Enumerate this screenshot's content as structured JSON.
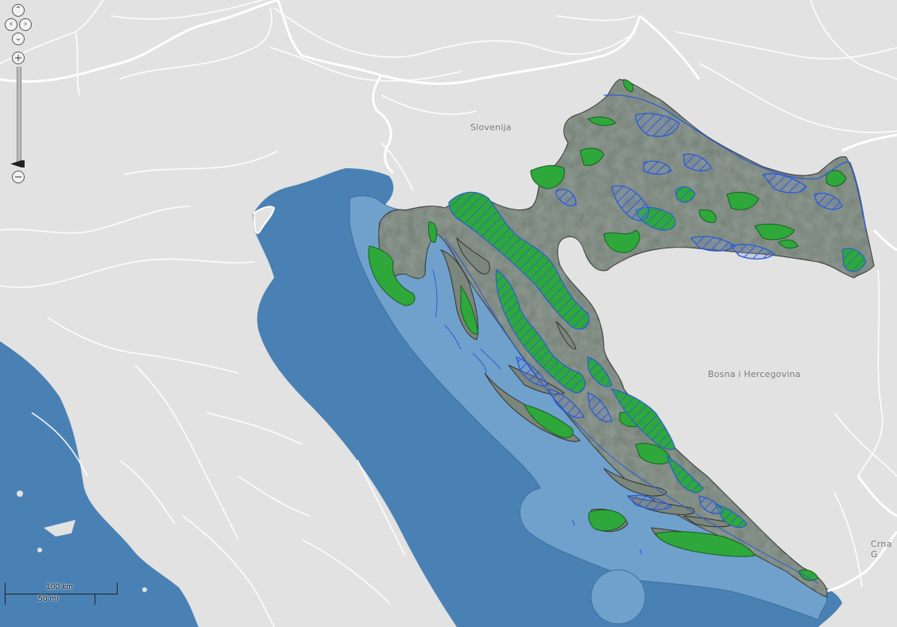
{
  "map": {
    "labels": {
      "slovenia": "Slovenija",
      "bosnia": "Bosna i Hercegovina",
      "montenegro": "Crna G"
    },
    "colors": {
      "land": "#e2e2e2",
      "sea": "#4a81b4",
      "territorial_sea": "#6fa1cc",
      "protected_area_fill": "#2ea83a",
      "protected_area_outline": "#2b5cd6",
      "border": "#ffffff",
      "satellite": "#6f7b72"
    },
    "legend_icons": [
      "pan-up-icon",
      "pan-left-icon",
      "pan-right-icon",
      "pan-down-icon",
      "zoom-in-icon",
      "zoom-out-icon"
    ]
  },
  "controls": {
    "pan_up": "⌃",
    "pan_left": "‹",
    "pan_right": "›",
    "pan_down": "⌄",
    "zoom_in": "+",
    "zoom_out": "−"
  },
  "scale_bar": {
    "km_label": "100 km",
    "mi_label": "50 mi"
  }
}
